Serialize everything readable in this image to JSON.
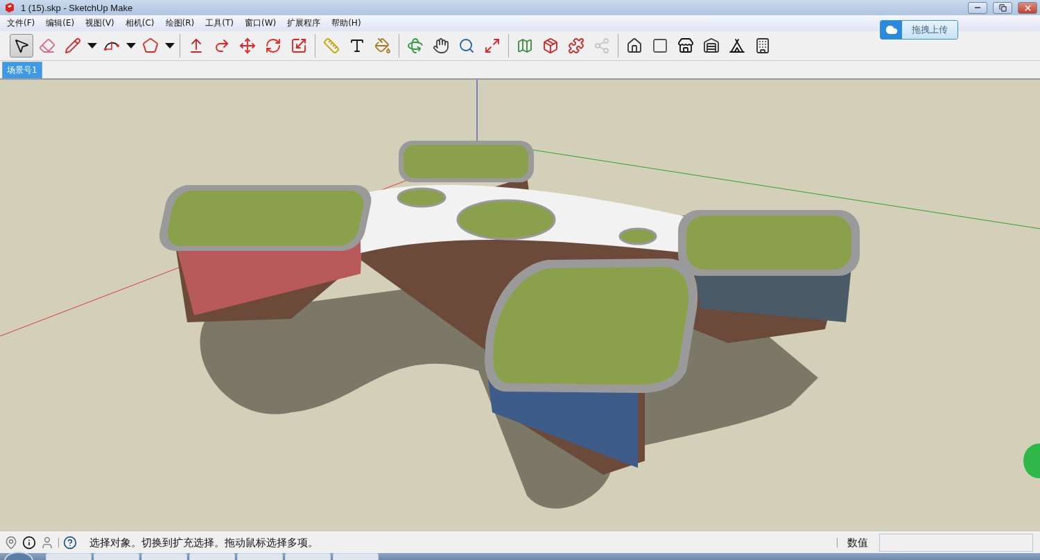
{
  "window": {
    "title": "1 (15).skp - SketchUp Make"
  },
  "menu": [
    {
      "label": "文件(F)"
    },
    {
      "label": "编辑(E)"
    },
    {
      "label": "视图(V)"
    },
    {
      "label": "相机(C)"
    },
    {
      "label": "绘图(R)"
    },
    {
      "label": "工具(T)"
    },
    {
      "label": "窗口(W)"
    },
    {
      "label": "扩展程序"
    },
    {
      "label": "帮助(H)"
    }
  ],
  "upload_widget": {
    "label": "拖拽上传"
  },
  "toolbar": [
    [
      {
        "kind": "select",
        "selected": true,
        "disabled": false,
        "dropdown": false
      },
      {
        "kind": "eraser",
        "selected": false,
        "disabled": false,
        "dropdown": false
      },
      {
        "kind": "pencil",
        "selected": false,
        "disabled": false,
        "dropdown": true
      },
      {
        "kind": "arc",
        "selected": false,
        "disabled": false,
        "dropdown": true
      },
      {
        "kind": "polygon",
        "selected": false,
        "disabled": false,
        "dropdown": true
      }
    ],
    [
      {
        "kind": "pushpull",
        "selected": false,
        "disabled": false,
        "dropdown": false
      },
      {
        "kind": "followme",
        "selected": false,
        "disabled": false,
        "dropdown": false
      },
      {
        "kind": "move",
        "selected": false,
        "disabled": false,
        "dropdown": false
      },
      {
        "kind": "rotate",
        "selected": false,
        "disabled": false,
        "dropdown": false
      },
      {
        "kind": "scale",
        "selected": false,
        "disabled": false,
        "dropdown": false
      }
    ],
    [
      {
        "kind": "tape",
        "selected": false,
        "disabled": false,
        "dropdown": false
      },
      {
        "kind": "text",
        "selected": false,
        "disabled": false,
        "dropdown": false
      },
      {
        "kind": "paint",
        "selected": false,
        "disabled": false,
        "dropdown": false
      }
    ],
    [
      {
        "kind": "orbit",
        "selected": false,
        "disabled": false,
        "dropdown": false
      },
      {
        "kind": "pan",
        "selected": false,
        "disabled": false,
        "dropdown": false
      },
      {
        "kind": "zoom",
        "selected": false,
        "disabled": false,
        "dropdown": false
      },
      {
        "kind": "extents",
        "selected": false,
        "disabled": false,
        "dropdown": false
      }
    ],
    [
      {
        "kind": "map",
        "selected": false,
        "disabled": false,
        "dropdown": false
      },
      {
        "kind": "warehouse",
        "selected": false,
        "disabled": false,
        "dropdown": false
      },
      {
        "kind": "extension",
        "selected": false,
        "disabled": false,
        "dropdown": false
      },
      {
        "kind": "share",
        "selected": false,
        "disabled": true,
        "dropdown": false
      }
    ],
    [
      {
        "kind": "iso",
        "selected": false,
        "disabled": false,
        "dropdown": false
      },
      {
        "kind": "top",
        "selected": false,
        "disabled": false,
        "dropdown": false
      },
      {
        "kind": "front",
        "selected": false,
        "disabled": false,
        "dropdown": false
      },
      {
        "kind": "right",
        "selected": false,
        "disabled": false,
        "dropdown": false
      },
      {
        "kind": "back",
        "selected": false,
        "disabled": false,
        "dropdown": false
      },
      {
        "kind": "left",
        "selected": false,
        "disabled": false,
        "dropdown": false
      }
    ]
  ],
  "scene_tabs": [
    {
      "label": "场景号1",
      "selected": true
    }
  ],
  "status_bar": {
    "message": "选择对象。切换到扩充选择。拖动鼠标选择多项。",
    "value_label": "数值"
  }
}
